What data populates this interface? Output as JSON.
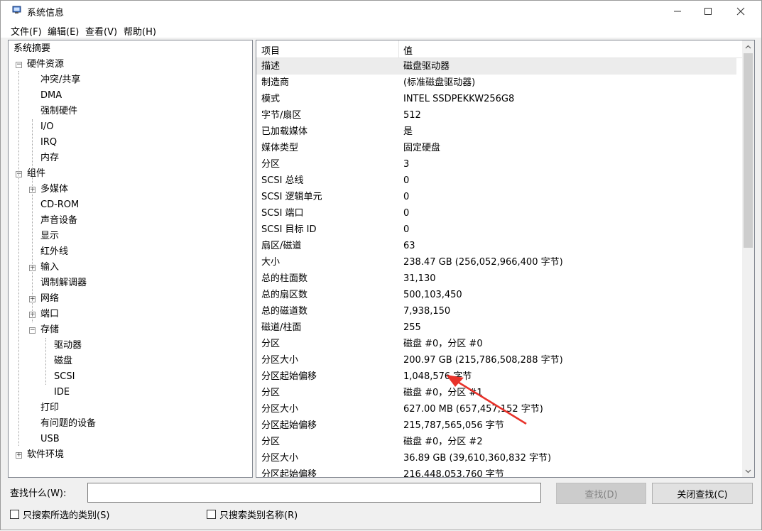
{
  "window": {
    "title": "系统信息"
  },
  "menu": [
    "文件(F)",
    "编辑(E)",
    "查看(V)",
    "帮助(H)"
  ],
  "tree": [
    {
      "label": "系统摘要",
      "level": 0,
      "toggle": "none"
    },
    {
      "label": "硬件资源",
      "level": 1,
      "toggle": "minus"
    },
    {
      "label": "冲突/共享",
      "level": 2,
      "toggle": "none"
    },
    {
      "label": "DMA",
      "level": 2,
      "toggle": "none"
    },
    {
      "label": "强制硬件",
      "level": 2,
      "toggle": "none"
    },
    {
      "label": "I/O",
      "level": 2,
      "toggle": "none"
    },
    {
      "label": "IRQ",
      "level": 2,
      "toggle": "none"
    },
    {
      "label": "内存",
      "level": 2,
      "toggle": "none"
    },
    {
      "label": "组件",
      "level": 1,
      "toggle": "minus"
    },
    {
      "label": "多媒体",
      "level": 2,
      "toggle": "plus"
    },
    {
      "label": "CD-ROM",
      "level": 2,
      "toggle": "none"
    },
    {
      "label": "声音设备",
      "level": 2,
      "toggle": "none"
    },
    {
      "label": "显示",
      "level": 2,
      "toggle": "none"
    },
    {
      "label": "红外线",
      "level": 2,
      "toggle": "none"
    },
    {
      "label": "输入",
      "level": 2,
      "toggle": "plus"
    },
    {
      "label": "调制解调器",
      "level": 2,
      "toggle": "none"
    },
    {
      "label": "网络",
      "level": 2,
      "toggle": "plus"
    },
    {
      "label": "端口",
      "level": 2,
      "toggle": "plus"
    },
    {
      "label": "存储",
      "level": 2,
      "toggle": "minus"
    },
    {
      "label": "驱动器",
      "level": 3,
      "toggle": "none"
    },
    {
      "label": "磁盘",
      "level": 3,
      "toggle": "none"
    },
    {
      "label": "SCSI",
      "level": 3,
      "toggle": "none"
    },
    {
      "label": "IDE",
      "level": 3,
      "toggle": "none"
    },
    {
      "label": "打印",
      "level": 2,
      "toggle": "none"
    },
    {
      "label": "有问题的设备",
      "level": 2,
      "toggle": "none"
    },
    {
      "label": "USB",
      "level": 2,
      "toggle": "none"
    },
    {
      "label": "软件环境",
      "level": 1,
      "toggle": "plus"
    }
  ],
  "list": {
    "headers": {
      "item": "项目",
      "value": "值"
    },
    "selected_index": 0,
    "rows": [
      {
        "item": "描述",
        "value": "磁盘驱动器"
      },
      {
        "item": "制造商",
        "value": "(标准磁盘驱动器)"
      },
      {
        "item": "模式",
        "value": "INTEL SSDPEKKW256G8"
      },
      {
        "item": "字节/扇区",
        "value": "512"
      },
      {
        "item": "已加载媒体",
        "value": "是"
      },
      {
        "item": "媒体类型",
        "value": "固定硬盘"
      },
      {
        "item": "分区",
        "value": "3"
      },
      {
        "item": "SCSI 总线",
        "value": "0"
      },
      {
        "item": "SCSI 逻辑单元",
        "value": "0"
      },
      {
        "item": "SCSI 端口",
        "value": "0"
      },
      {
        "item": "SCSI 目标 ID",
        "value": "0"
      },
      {
        "item": "扇区/磁道",
        "value": "63"
      },
      {
        "item": "大小",
        "value": "238.47 GB (256,052,966,400 字节)"
      },
      {
        "item": "总的柱面数",
        "value": "31,130"
      },
      {
        "item": "总的扇区数",
        "value": "500,103,450"
      },
      {
        "item": "总的磁道数",
        "value": "7,938,150"
      },
      {
        "item": "磁道/柱面",
        "value": "255"
      },
      {
        "item": "分区",
        "value": "磁盘 #0，分区 #0"
      },
      {
        "item": "分区大小",
        "value": "200.97 GB (215,786,508,288 字节)"
      },
      {
        "item": "分区起始偏移",
        "value": "1,048,576 字节"
      },
      {
        "item": "分区",
        "value": "磁盘 #0，分区 #1"
      },
      {
        "item": "分区大小",
        "value": "627.00 MB (657,457,152 字节)"
      },
      {
        "item": "分区起始偏移",
        "value": "215,787,565,056 字节"
      },
      {
        "item": "分区",
        "value": "磁盘 #0，分区 #2"
      },
      {
        "item": "分区大小",
        "value": "36.89 GB (39,610,360,832 字节)"
      },
      {
        "item": "分区起始偏移",
        "value": "216,448,053,760 字节"
      }
    ]
  },
  "find": {
    "label": "查找什么(W):",
    "input_value": "",
    "find_button": "查找(D)",
    "close_button": "关闭查找(C)",
    "checkbox_selected_category": "只搜索所选的类别(S)",
    "checkbox_category_names": "只搜索类别名称(R)"
  },
  "colors": {
    "annotation_arrow": "#e8322a",
    "selection": "#ececec"
  },
  "icons": [
    "system-info-app-icon",
    "minimize-icon",
    "maximize-icon",
    "close-icon",
    "scroll-up-icon",
    "scroll-down-icon"
  ]
}
